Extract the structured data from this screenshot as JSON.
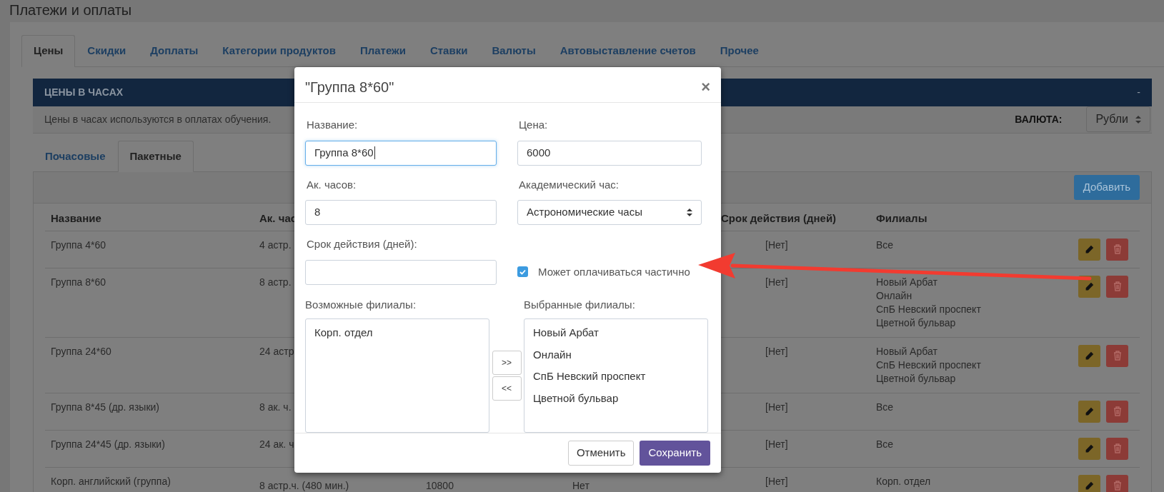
{
  "page_title": "Платежи и оплаты",
  "tabs": [
    {
      "label": "Цены",
      "selected": true
    },
    {
      "label": "Скидки",
      "selected": false
    },
    {
      "label": "Доплаты",
      "selected": false
    },
    {
      "label": "Категории продуктов",
      "selected": false
    },
    {
      "label": "Платежи",
      "selected": false
    },
    {
      "label": "Ставки",
      "selected": false
    },
    {
      "label": "Валюты",
      "selected": false
    },
    {
      "label": "Автовыставление счетов",
      "selected": false
    },
    {
      "label": "Прочее",
      "selected": false
    }
  ],
  "section": {
    "title": "ЦЕНЫ В ЧАСАХ",
    "collapse": "-",
    "description": "Цены в часах используются в оплатах обучения.",
    "currency_label": "ВАЛЮТА:",
    "currency_value": "Рубли"
  },
  "subtabs": [
    {
      "label": "Почасовые",
      "selected": false
    },
    {
      "label": "Пакетные",
      "selected": true
    }
  ],
  "add_button": "Добавить",
  "table": {
    "columns": [
      "Название",
      "Ак. час",
      "Срок действия (дней)",
      "Филиалы"
    ],
    "rows": [
      {
        "name": "Группа 4*60",
        "hours": "4 астр.",
        "validity": "[Нет]",
        "branches": [
          "Все"
        ]
      },
      {
        "name": "Группа 8*60",
        "hours": "8 астр.",
        "validity": "[Нет]",
        "branches": [
          "Новый Арбат",
          "Онлайн",
          "СпБ Невский проспект",
          "Цветной бульвар"
        ]
      },
      {
        "name": "Группа 24*60",
        "hours": "24 астр",
        "validity": "[Нет]",
        "branches": [
          "Новый Арбат",
          "СпБ Невский проспект",
          "Цветной бульвар"
        ]
      },
      {
        "name": "Группа 8*45 (др. языки)",
        "hours": "8 ак. ч.",
        "validity": "[Нет]",
        "branches": [
          "Все"
        ]
      },
      {
        "name": "Группа 24*45 (др. языки)",
        "hours": "24 ак. ч",
        "validity": "[Нет]",
        "branches": [
          "Все"
        ]
      },
      {
        "name": "Корп. английский (группа)",
        "hours": "8 астр.ч. (480 мин.)",
        "column_3": "10800",
        "column_4": "Нет",
        "validity": "[Нет]",
        "branches": [
          "Корп. отдел"
        ]
      }
    ]
  },
  "modal": {
    "title": "\"Группа 8*60\"",
    "close": "×",
    "fields": [
      {
        "kind": "text",
        "label": "Название:",
        "value": "Группа 8*60",
        "focused": true
      },
      {
        "kind": "text",
        "label": "Цена:",
        "value": "6000",
        "focused": false
      },
      {
        "kind": "text",
        "label": "Ак. часов:",
        "value": "8",
        "focused": false
      },
      {
        "kind": "select",
        "label": "Академический час:",
        "value": "Астрономические часы"
      },
      {
        "kind": "text",
        "label": "Срок действия (дней):",
        "focused": false
      },
      {
        "kind": "checkbox",
        "label": "Может оплачиваться частично",
        "checked": true
      }
    ],
    "available_label": "Возможные филиалы:",
    "available": [
      "Корп. отдел"
    ],
    "selected_label": "Выбранные филиалы:",
    "selected": [
      "Новый Арбат",
      "Онлайн",
      "СпБ Невский проспект",
      "Цветной бульвар"
    ],
    "move_right": ">>",
    "move_left": "<<",
    "cancel": "Отменить",
    "save": "Сохранить"
  }
}
